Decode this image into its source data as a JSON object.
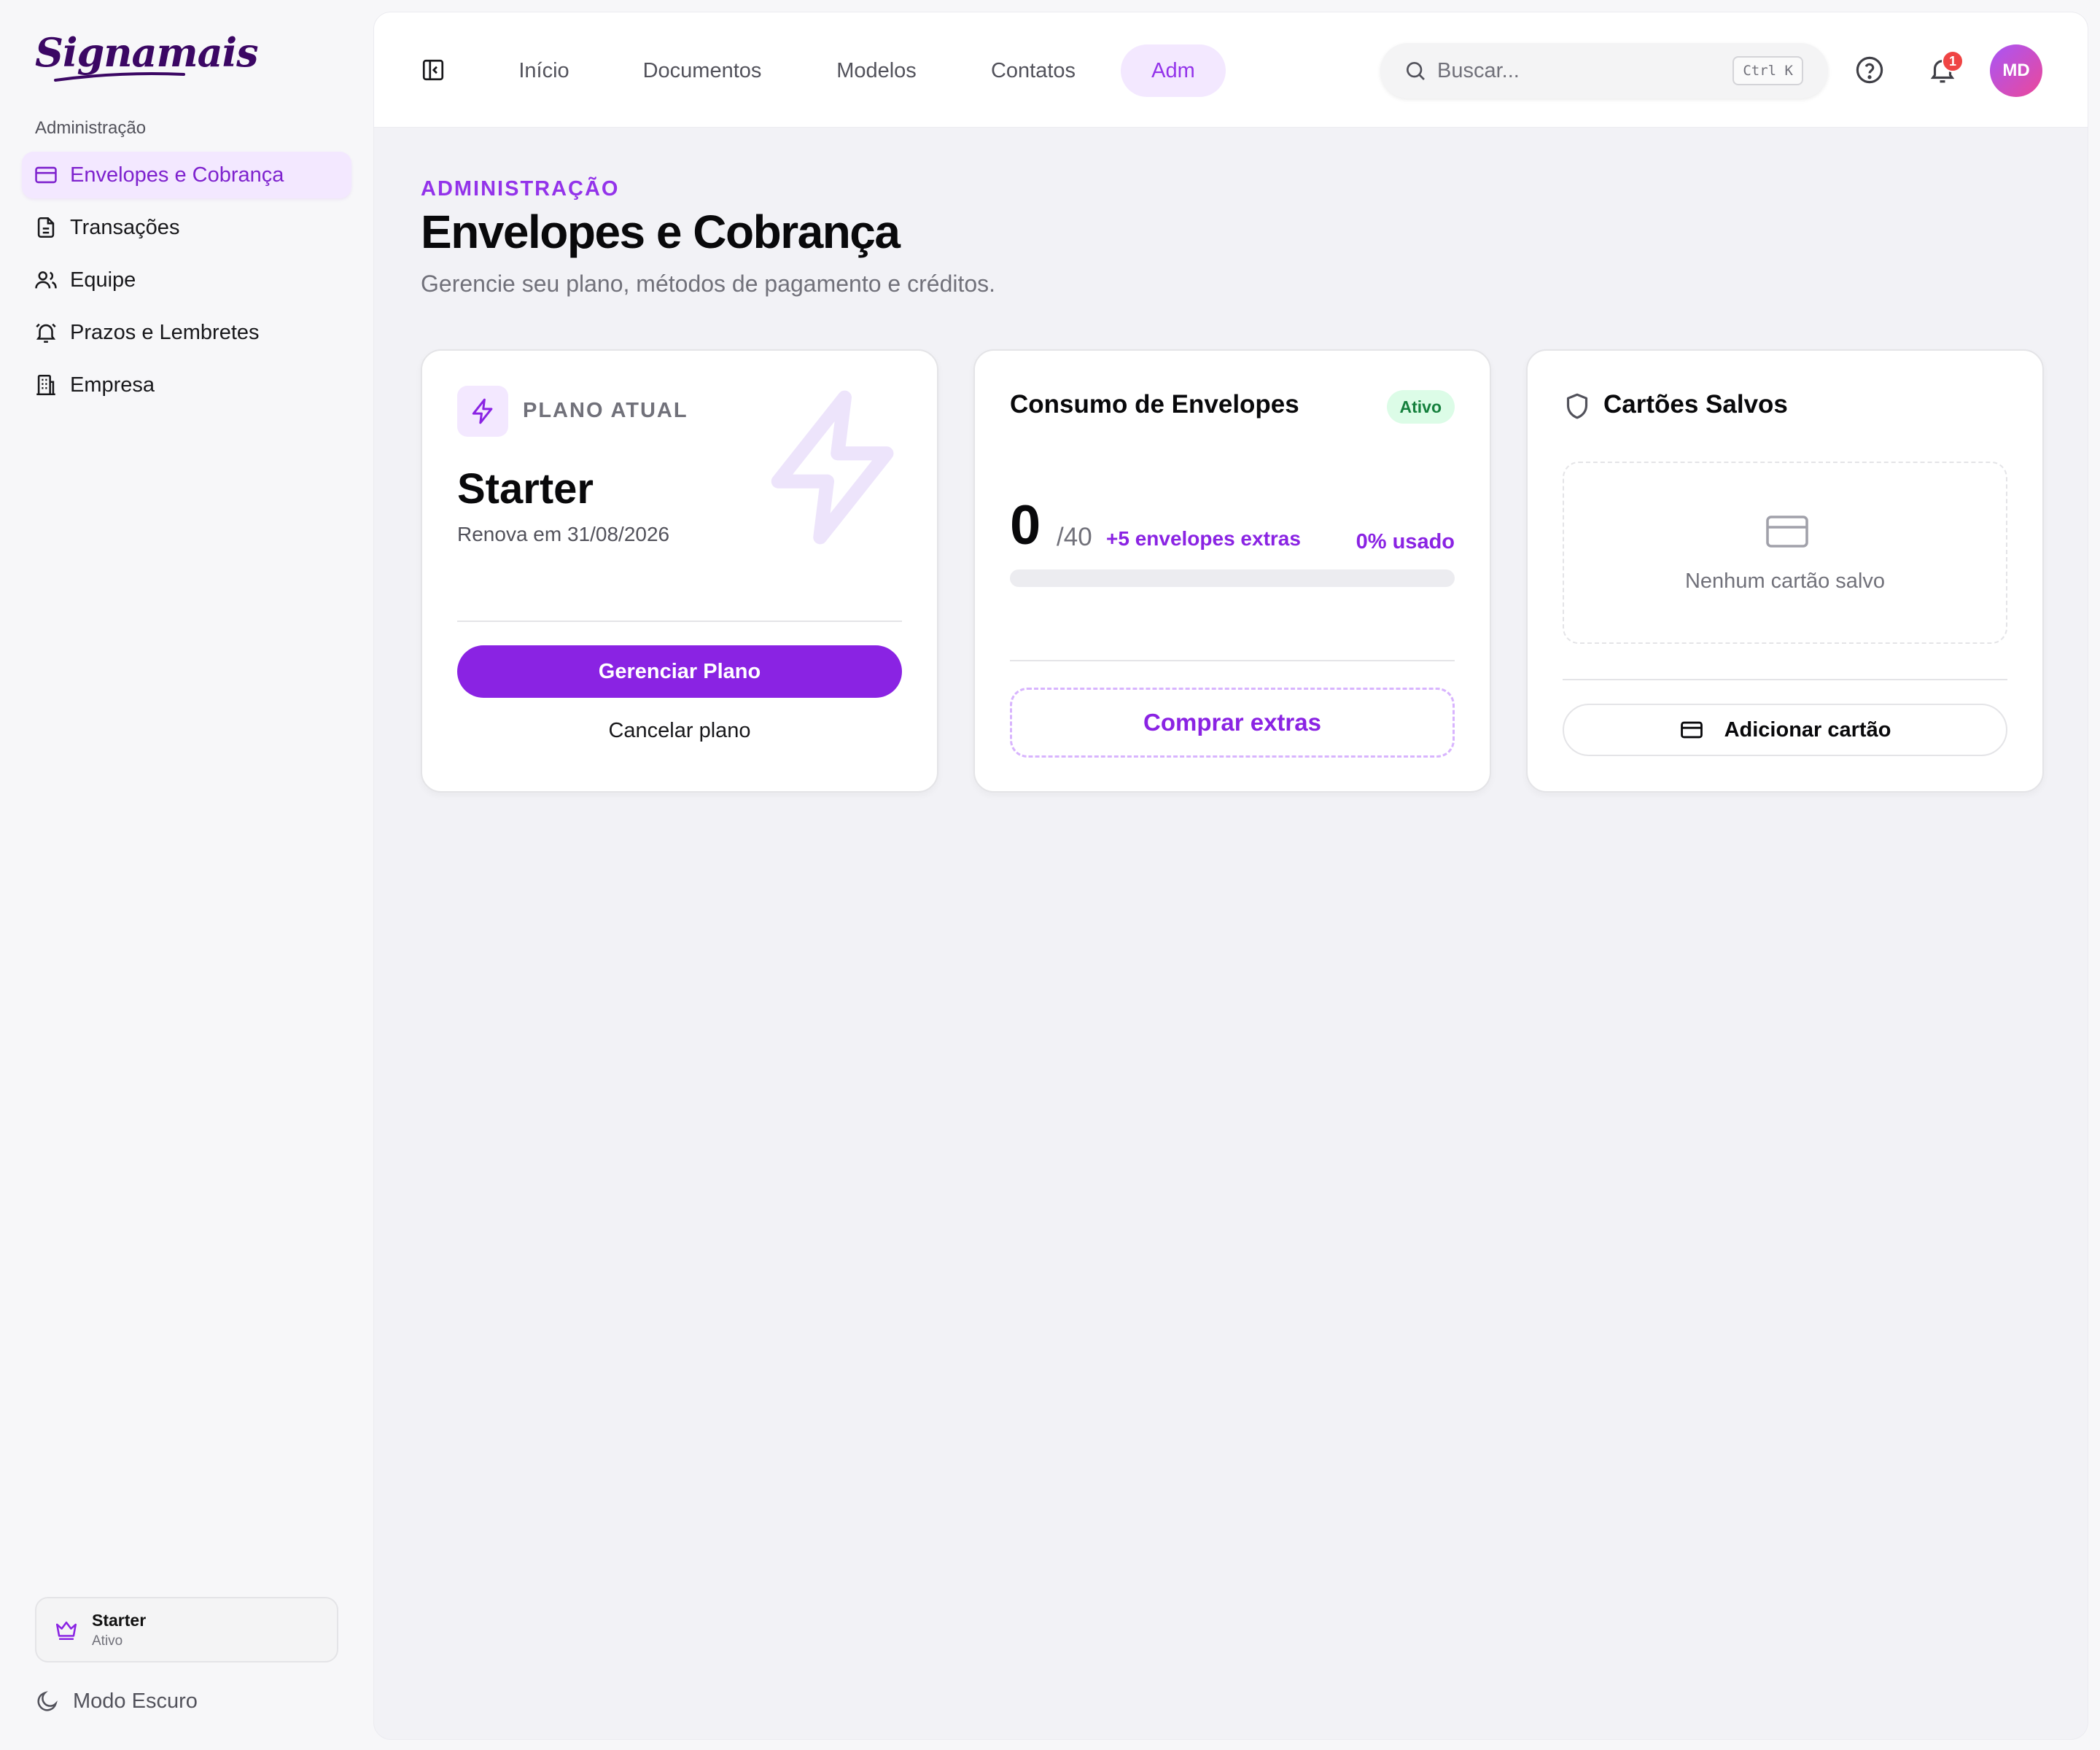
{
  "brand": {
    "name": "Signamais"
  },
  "sidebar": {
    "section_label": "Administração",
    "items": [
      {
        "label": "Envelopes e Cobrança",
        "icon": "credit-card-icon",
        "active": true
      },
      {
        "label": "Transações",
        "icon": "document-icon",
        "active": false
      },
      {
        "label": "Equipe",
        "icon": "users-icon",
        "active": false
      },
      {
        "label": "Prazos e Lembretes",
        "icon": "alarm-bell-icon",
        "active": false
      },
      {
        "label": "Empresa",
        "icon": "building-icon",
        "active": false
      }
    ],
    "plan_badge": {
      "name": "Starter",
      "status": "Ativo",
      "icon": "crown-icon"
    },
    "dark_mode_label": "Modo Escuro"
  },
  "topbar": {
    "tabs": [
      {
        "label": "Início",
        "active": false
      },
      {
        "label": "Documentos",
        "active": false
      },
      {
        "label": "Modelos",
        "active": false
      },
      {
        "label": "Contatos",
        "active": false
      },
      {
        "label": "Adm",
        "active": true
      }
    ],
    "search": {
      "placeholder": "Buscar...",
      "value": "",
      "shortcut": "Ctrl K"
    },
    "notification_count": "1",
    "avatar_initials": "MD"
  },
  "page": {
    "eyebrow": "ADMINISTRAÇÃO",
    "title": "Envelopes e Cobrança",
    "subtitle": "Gerencie seu plano, métodos de pagamento e créditos."
  },
  "plan_card": {
    "label": "PLANO ATUAL",
    "plan_name": "Starter",
    "renew_text": "Renova em 31/08/2026",
    "manage_button": "Gerenciar Plano",
    "cancel_button": "Cancelar plano"
  },
  "usage_card": {
    "title": "Consumo de Envelopes",
    "status": "Ativo",
    "used": "0",
    "limit": "/40",
    "extras": "+5 envelopes extras",
    "percent_label": "0% usado",
    "progress_fraction": 0,
    "buy_button": "Comprar extras"
  },
  "cards_card": {
    "title": "Cartões Salvos",
    "empty_text": "Nenhum cartão salvo",
    "add_button": "Adicionar cartão"
  },
  "colors": {
    "accent": "#8a23e3",
    "accent_soft": "#f3e8ff",
    "success_bg": "#dcfce7",
    "success_text": "#15803d",
    "danger": "#ef4444"
  }
}
